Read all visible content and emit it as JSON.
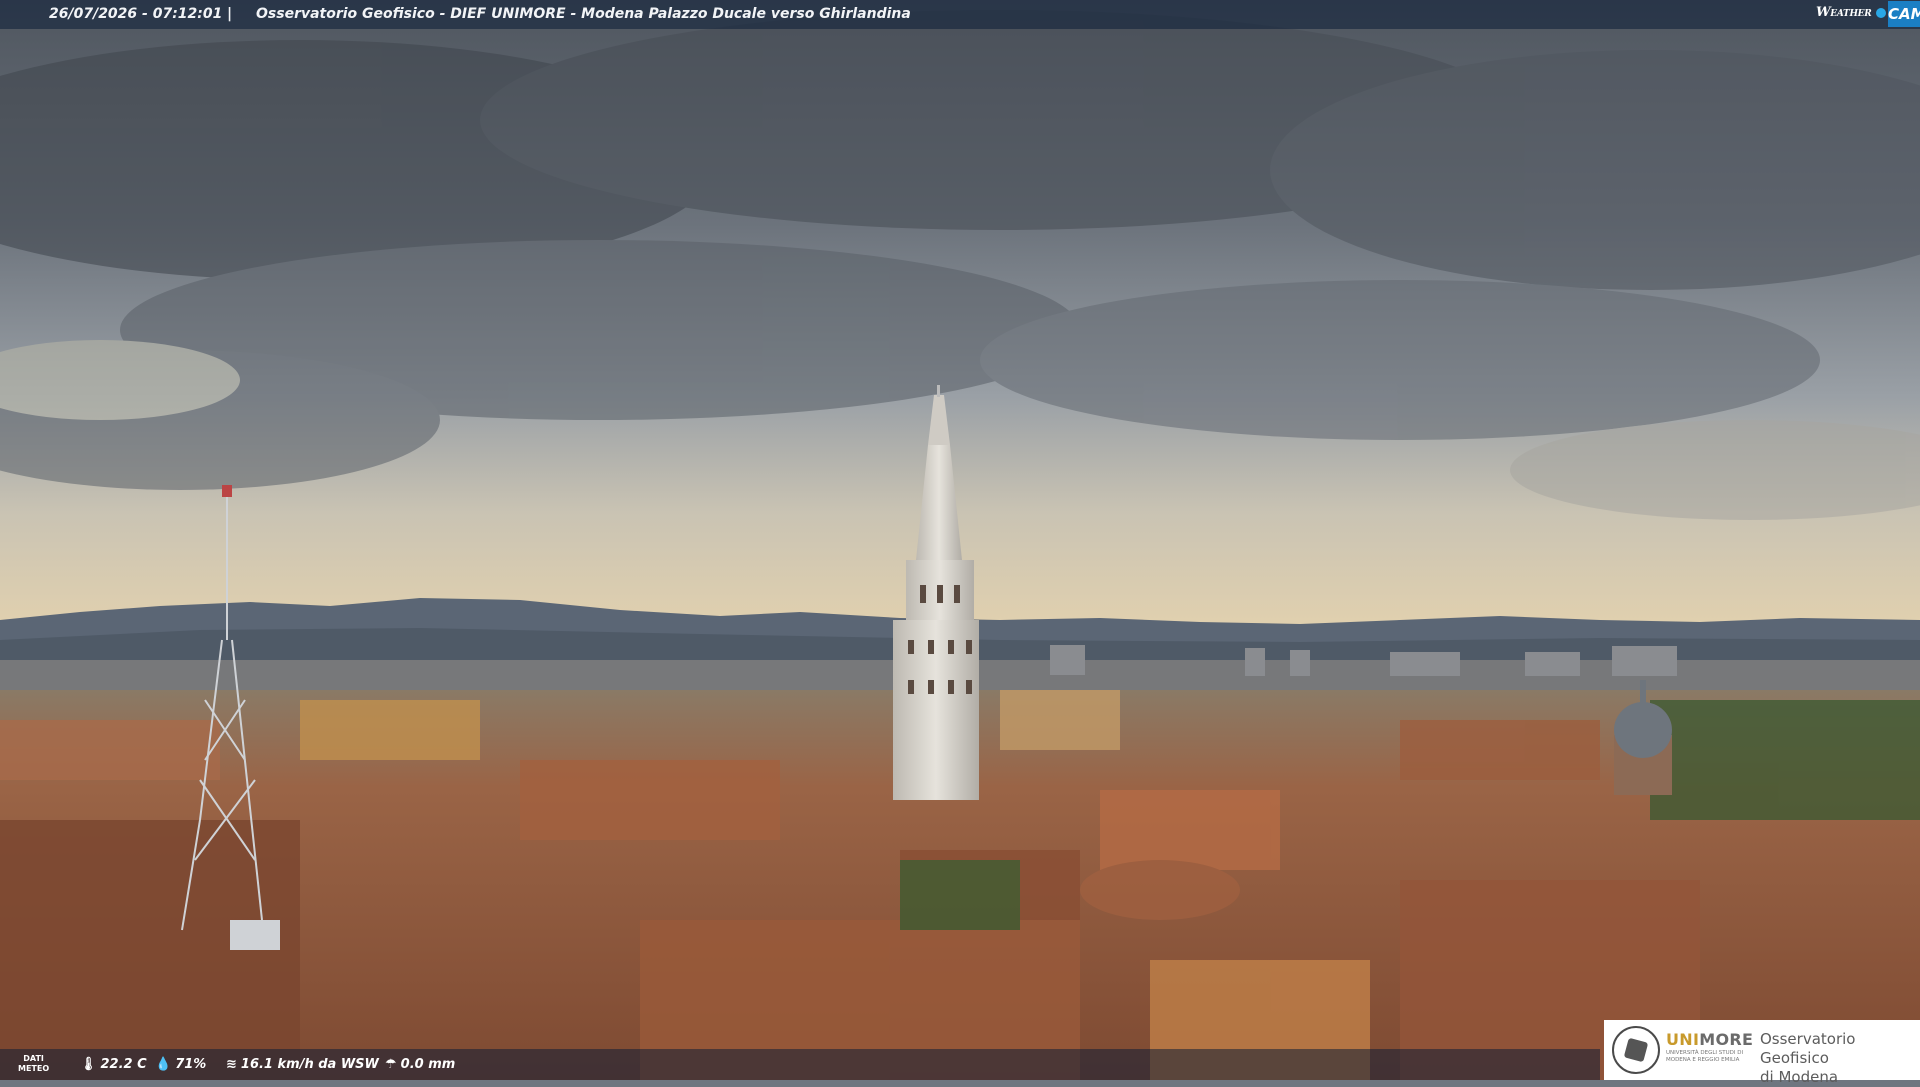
{
  "header": {
    "timestamp": "26/07/2026 - 07:12:01",
    "separator": "|",
    "location": "Osservatorio Geofisico - DIEF UNIMORE - Modena Palazzo Ducale verso Ghirlandina"
  },
  "brand": {
    "weather": "Weather",
    "cam": "CAM"
  },
  "weather_bar": {
    "dati_label_line1": "DATI",
    "dati_label_line2": "METEO",
    "temperature": "22.2 C",
    "humidity": "71%",
    "wind": "16.1 km/h da WSW",
    "rain": "0.0 mm"
  },
  "logo": {
    "name_part1": "UNI",
    "name_part2": "MORE",
    "subtitle": "UNIVERSITÀ DEGLI STUDI DI MODENA E REGGIO EMILIA",
    "observatory_line1": "Osservatorio Geofisico",
    "observatory_line2": "di Modena"
  },
  "colors": {
    "sky_top": "#4f565f",
    "sky_mid": "#8a919a",
    "sky_horizon": "#d8c9a6",
    "mountains": "#5b6675",
    "roofs": "#9c5a3c",
    "tower": "#d9d6cf"
  }
}
